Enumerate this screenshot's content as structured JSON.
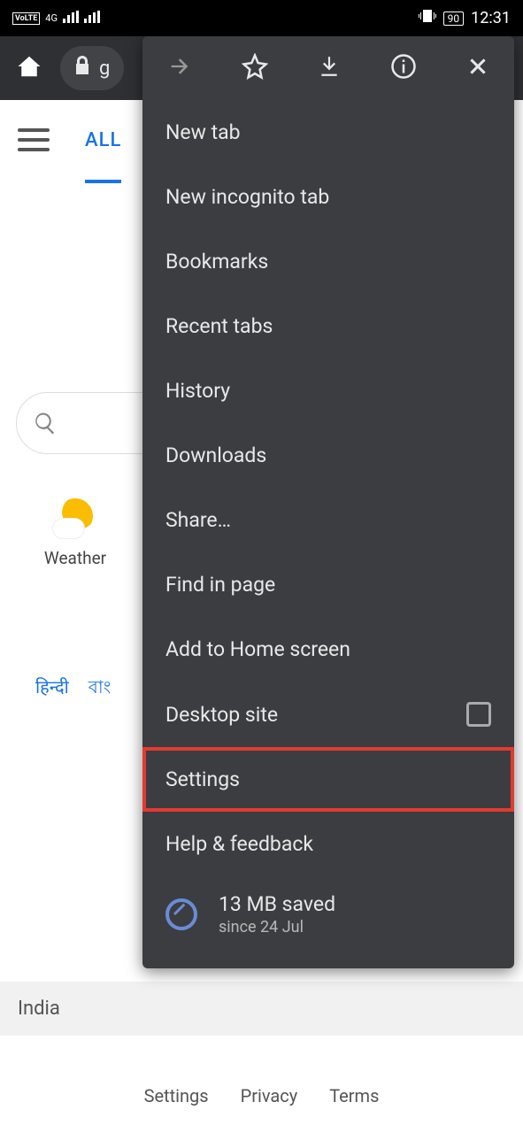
{
  "status": {
    "battery": "90",
    "time": "12:31",
    "network": "4G"
  },
  "browser": {
    "url_char": "g"
  },
  "tabs": {
    "all": "ALL"
  },
  "weather": {
    "label": "Weather"
  },
  "langs": [
    "हिन्दी",
    "বাং"
  ],
  "india": "India",
  "footer": {
    "settings": "Settings",
    "privacy": "Privacy",
    "terms": "Terms"
  },
  "menu": {
    "items": [
      "New tab",
      "New incognito tab",
      "Bookmarks",
      "Recent tabs",
      "History",
      "Downloads",
      "Share…",
      "Find in page",
      "Add to Home screen",
      "Desktop site",
      "Settings",
      "Help & feedback"
    ],
    "data_saver_title": "13 MB saved",
    "data_saver_sub": "since 24 Jul"
  }
}
